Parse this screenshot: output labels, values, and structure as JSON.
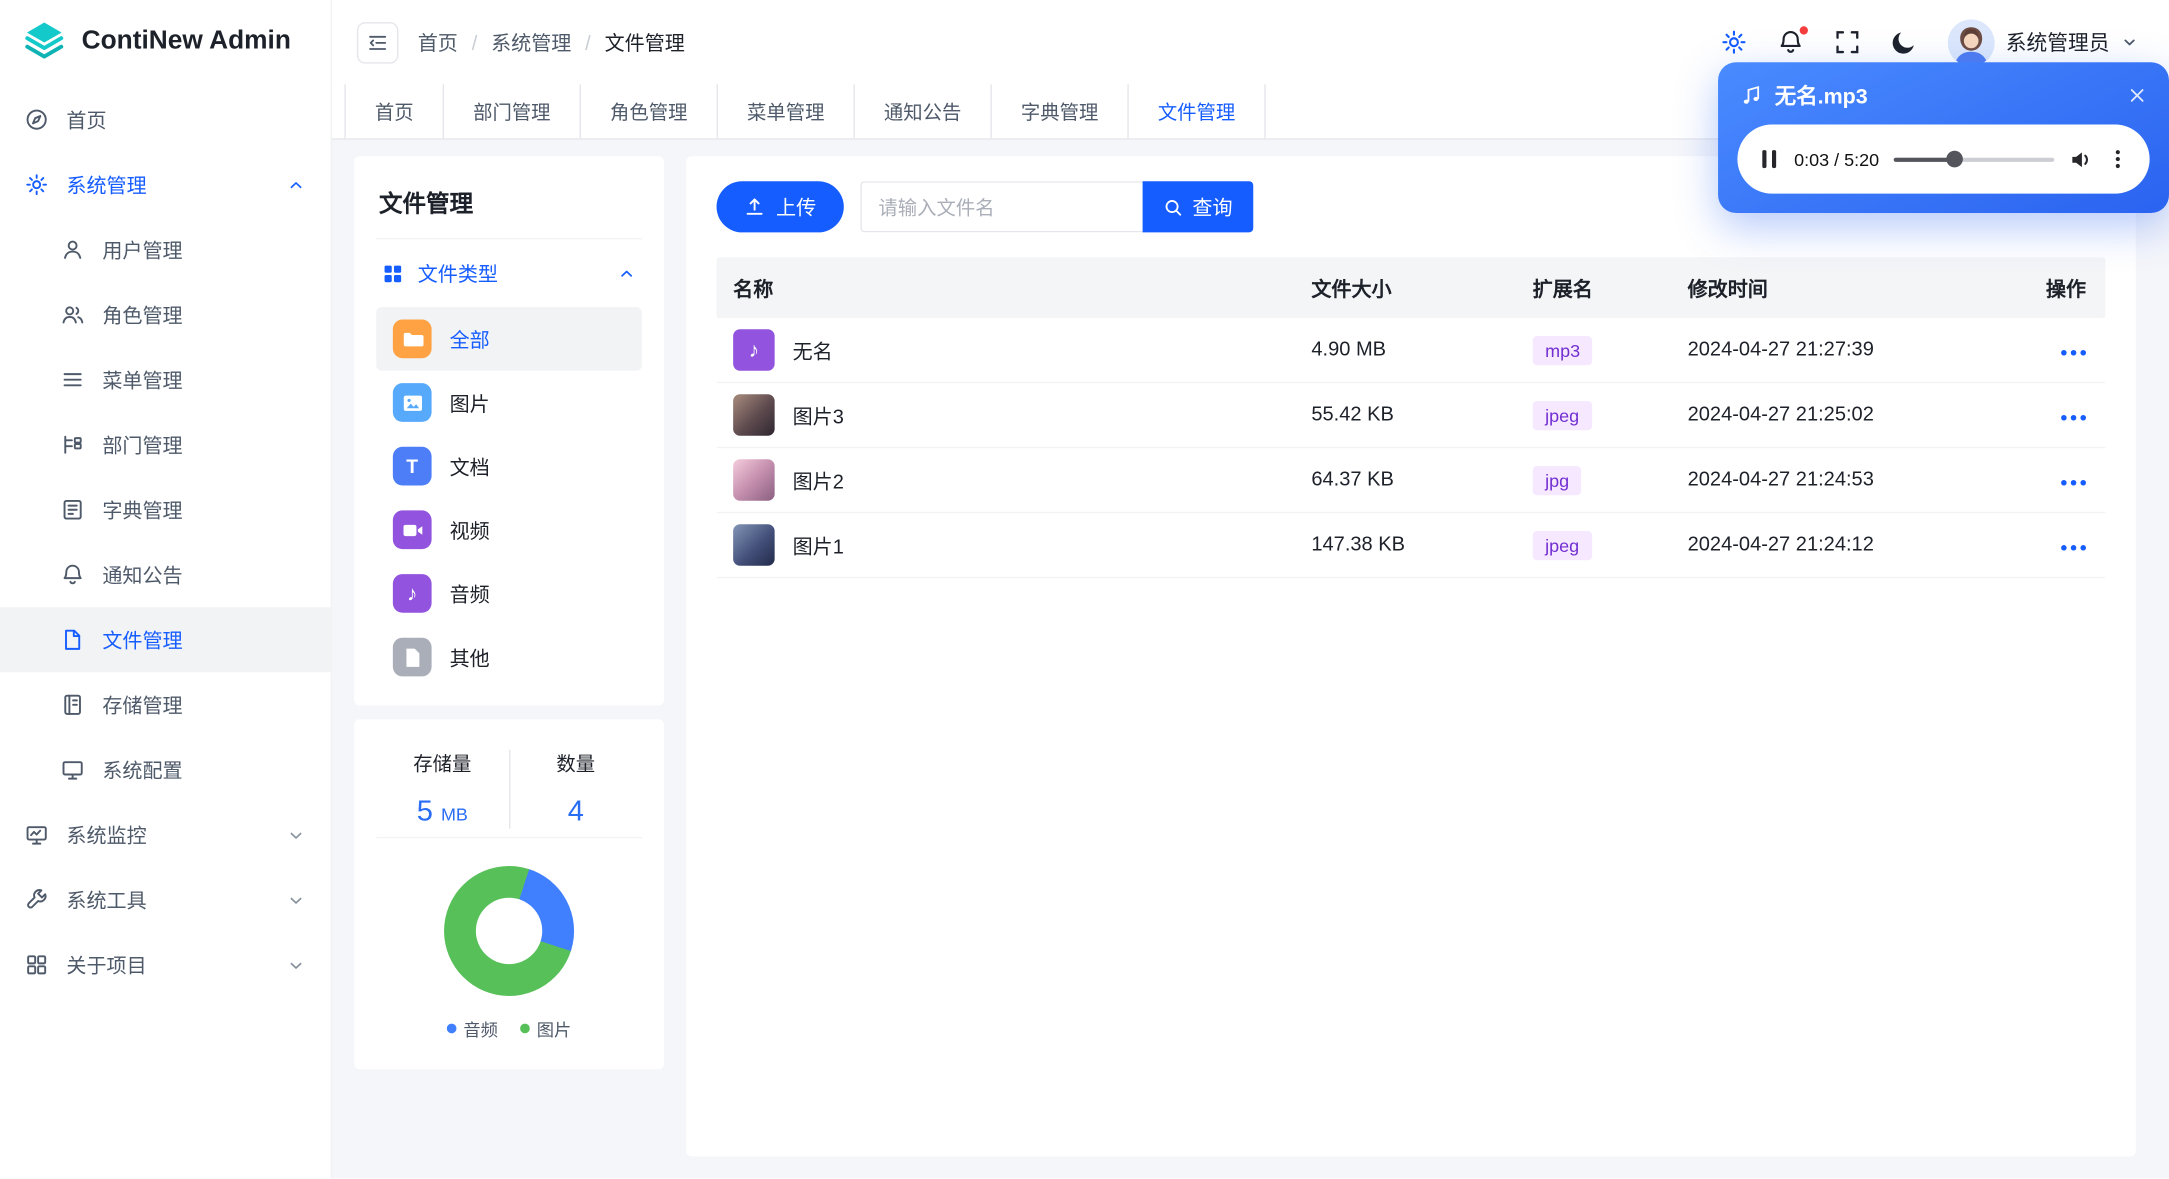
{
  "app": {
    "logo_text": "ContiNew Admin"
  },
  "header": {
    "breadcrumb": [
      "首页",
      "系统管理",
      "文件管理"
    ],
    "user_name": "系统管理员"
  },
  "tabs": [
    "首页",
    "部门管理",
    "角色管理",
    "菜单管理",
    "通知公告",
    "字典管理",
    "文件管理"
  ],
  "active_tab": "文件管理",
  "sidebar": {
    "items": [
      {
        "label": "首页"
      },
      {
        "label": "系统管理",
        "expanded": true
      },
      {
        "label": "用户管理"
      },
      {
        "label": "角色管理"
      },
      {
        "label": "菜单管理"
      },
      {
        "label": "部门管理"
      },
      {
        "label": "字典管理"
      },
      {
        "label": "通知公告"
      },
      {
        "label": "文件管理",
        "active": true
      },
      {
        "label": "存储管理"
      },
      {
        "label": "系统配置"
      },
      {
        "label": "系统监控",
        "collapsed": true
      },
      {
        "label": "系统工具",
        "collapsed": true
      },
      {
        "label": "关于项目",
        "collapsed": true
      }
    ]
  },
  "file_panel": {
    "title": "文件管理",
    "group_title": "文件类型",
    "types": [
      {
        "label": "全部",
        "selected": true
      },
      {
        "label": "图片"
      },
      {
        "label": "文档"
      },
      {
        "label": "视频"
      },
      {
        "label": "音频"
      },
      {
        "label": "其他"
      }
    ]
  },
  "stats": {
    "storage_label": "存储量",
    "storage_value": "5",
    "storage_unit": "MB",
    "count_label": "数量",
    "count_value": "4"
  },
  "chart_data": {
    "type": "pie",
    "donut": true,
    "categories": [
      "音频",
      "图片"
    ],
    "values": [
      1,
      3
    ],
    "percentages": [
      25,
      75
    ],
    "colors": [
      "#4080FF",
      "#57C059"
    ],
    "legend_position": "bottom"
  },
  "toolbar": {
    "upload_label": "上传",
    "search_placeholder": "请输入文件名",
    "query_label": "查询"
  },
  "table": {
    "columns": [
      "名称",
      "文件大小",
      "扩展名",
      "修改时间",
      "操作"
    ],
    "rows": [
      {
        "name": "无名",
        "size": "4.90 MB",
        "ext": "mp3",
        "time": "2024-04-27 21:27:39",
        "kind": "audio"
      },
      {
        "name": "图片3",
        "size": "55.42 KB",
        "ext": "jpeg",
        "time": "2024-04-27 21:25:02",
        "kind": "image"
      },
      {
        "name": "图片2",
        "size": "64.37 KB",
        "ext": "jpg",
        "time": "2024-04-27 21:24:53",
        "kind": "image"
      },
      {
        "name": "图片1",
        "size": "147.38 KB",
        "ext": "jpeg",
        "time": "2024-04-27 21:24:12",
        "kind": "image"
      }
    ]
  },
  "player": {
    "title": "无名.mp3",
    "time": "0:03 / 5:20"
  },
  "icons": {
    "audio_glyph": "♪",
    "doc_glyph": "T"
  },
  "colors": {
    "primary": "#165DFF",
    "badge_bg": "#F5E8FF",
    "badge_text": "#722ED1",
    "player_gradient_start": "#4A8BFF",
    "player_gradient_end": "#2A63F0"
  }
}
